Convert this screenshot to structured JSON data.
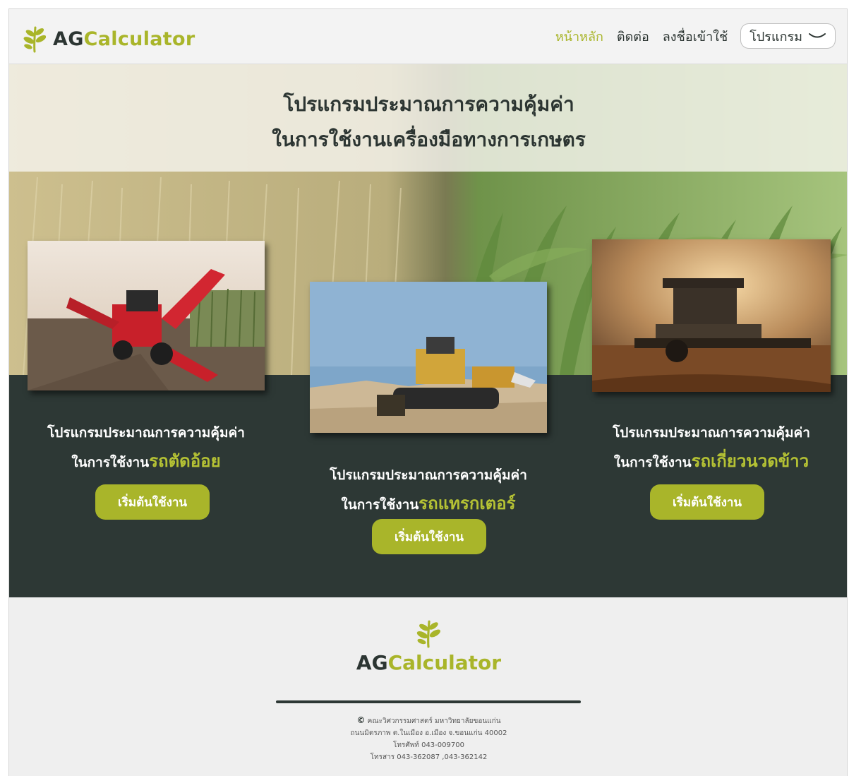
{
  "brand": {
    "part1": "AG",
    "part2": "Calculator"
  },
  "nav": {
    "home": "หน้าหลัก",
    "contact": "ติดต่อ",
    "login": "ลงชื่อเข้าใช้",
    "program": "โปรแกรม"
  },
  "hero": {
    "line1": "โปรแกรมประมาณการความคุ้มค่า",
    "line2": "ในการใช้งานเครื่องมือทางการเกษตร"
  },
  "cards": [
    {
      "line1": "โปรแกรมประมาณการความคุ้มค่า",
      "line2_prefix": "ในการใช้งาน",
      "line2_highlight": "รถตัดอ้อย",
      "button": "เริ่มต้นใช้งาน"
    },
    {
      "line1": "โปรแกรมประมาณการความคุ้มค่า",
      "line2_prefix": "ในการใช้งาน",
      "line2_highlight": "รถแทรกเตอร์",
      "button": "เริ่มต้นใช้งาน"
    },
    {
      "line1": "โปรแกรมประมาณการความคุ้มค่า",
      "line2_prefix": "ในการใช้งาน",
      "line2_highlight": "รถเกี่ยวนวดข้าว",
      "button": "เริ่มต้นใช้งาน"
    }
  ],
  "footer": {
    "brand_part1": "AG",
    "brand_part2": "Calculator",
    "org": "คณะวิศวกรรมศาสตร์ มหาวิทยาลัยขอนแก่น",
    "address": "ถนนมิตรภาพ ต.ในเมือง อ.เมือง จ.ขอนแก่น 40002",
    "phone": "โทรศัพท์ 043-009700",
    "fax": "โทรสาร 043-362087 ,043-362142"
  },
  "colors": {
    "accent": "#a9b52a",
    "dark": "#2d3835",
    "text": "#2c3532"
  },
  "icons": {
    "logo": "leaf-logo-icon",
    "dropdown": "chevron-down-icon",
    "copyright": "copyright-icon"
  }
}
